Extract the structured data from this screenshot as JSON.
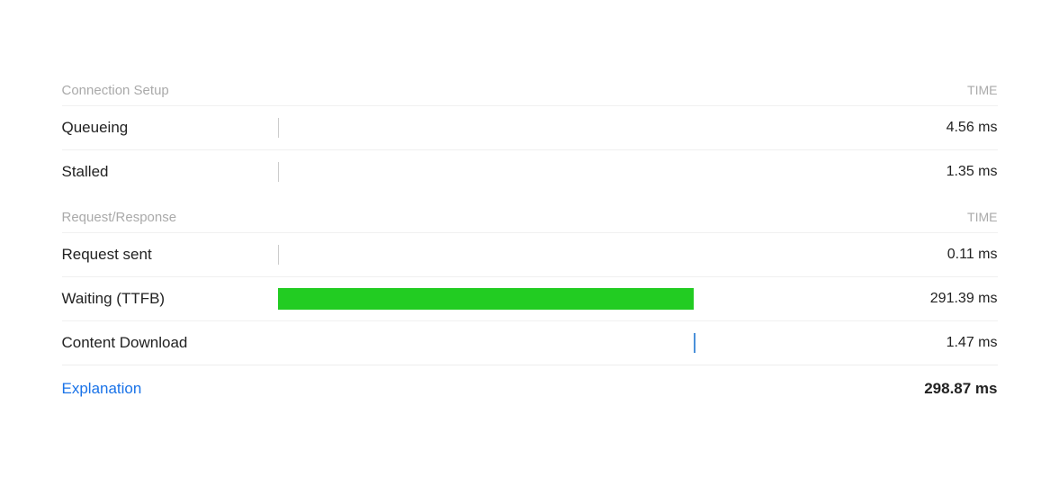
{
  "sections": [
    {
      "name": "connection-setup",
      "label": "Connection Setup",
      "time_header": "TIME",
      "rows": [
        {
          "label": "Queueing",
          "time": "4.56 ms",
          "bar_type": "tick",
          "bar_color": null
        },
        {
          "label": "Stalled",
          "time": "1.35 ms",
          "bar_type": "tick",
          "bar_color": null
        }
      ]
    },
    {
      "name": "request-response",
      "label": "Request/Response",
      "time_header": "TIME",
      "rows": [
        {
          "label": "Request sent",
          "time": "0.11 ms",
          "bar_type": "tick",
          "bar_color": null
        },
        {
          "label": "Waiting (TTFB)",
          "time": "291.39 ms",
          "bar_type": "green",
          "bar_color": "#22cc22",
          "bar_width_pct": 68
        },
        {
          "label": "Content Download",
          "time": "1.47 ms",
          "bar_type": "blue-tick",
          "bar_color": null
        }
      ]
    }
  ],
  "footer": {
    "explanation_label": "Explanation",
    "total_time": "298.87 ms"
  }
}
